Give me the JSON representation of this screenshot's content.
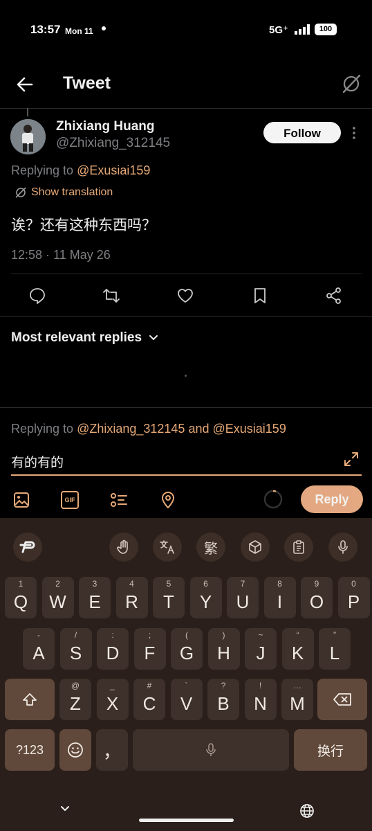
{
  "status": {
    "time": "13:57",
    "date": "Mon 11",
    "network": "5G⁺",
    "battery": "100"
  },
  "header": {
    "title": "Tweet"
  },
  "tweet": {
    "author_name": "Zhixiang Huang",
    "author_handle": "@Zhixiang_312145",
    "follow_label": "Follow",
    "replying_prefix": "Replying to ",
    "replying_to": "@Exusiai159",
    "show_translation": "Show translation",
    "text": "诶？还有这种东西吗？",
    "timestamp": "12:58 · 11 May 26"
  },
  "replies": {
    "sort_label": "Most relevant replies"
  },
  "composer": {
    "replying_prefix": "Replying to ",
    "mention1": "@Zhixiang_312145",
    "and": " and ",
    "mention2": "@Exusiai159",
    "input_value": "有的有的",
    "reply_label": "Reply",
    "gif_label": "GIF"
  },
  "keyboard": {
    "tools": [
      "logo-p",
      "gesture-icon",
      "translate-icon",
      "繁",
      "cube-icon",
      "clipboard-icon",
      "mic-icon"
    ],
    "traditional_label": "繁",
    "row1": [
      {
        "k": "Q",
        "h": "1"
      },
      {
        "k": "W",
        "h": "2"
      },
      {
        "k": "E",
        "h": "3"
      },
      {
        "k": "R",
        "h": "4"
      },
      {
        "k": "T",
        "h": "5"
      },
      {
        "k": "Y",
        "h": "6"
      },
      {
        "k": "U",
        "h": "7"
      },
      {
        "k": "I",
        "h": "8"
      },
      {
        "k": "O",
        "h": "9"
      },
      {
        "k": "P",
        "h": "0"
      }
    ],
    "row2": [
      {
        "k": "A",
        "h": "-"
      },
      {
        "k": "S",
        "h": "/"
      },
      {
        "k": "D",
        "h": ":"
      },
      {
        "k": "F",
        "h": ";"
      },
      {
        "k": "G",
        "h": "("
      },
      {
        "k": "H",
        "h": ")"
      },
      {
        "k": "J",
        "h": "~"
      },
      {
        "k": "K",
        "h": "“"
      },
      {
        "k": "L",
        "h": "”"
      }
    ],
    "row3": [
      {
        "k": "Z",
        "h": "@"
      },
      {
        "k": "X",
        "h": "_"
      },
      {
        "k": "C",
        "h": "#"
      },
      {
        "k": "V",
        "h": "`"
      },
      {
        "k": "B",
        "h": "?"
      },
      {
        "k": "N",
        "h": "!"
      },
      {
        "k": "M",
        "h": "…"
      }
    ],
    "symbols_label": "?123",
    "comma_label": "，",
    "enter_label": "换行"
  },
  "colors": {
    "accent": "#e7a977",
    "reply_button": "#f0b288",
    "keyboard_bg": "#2a1f1a"
  }
}
